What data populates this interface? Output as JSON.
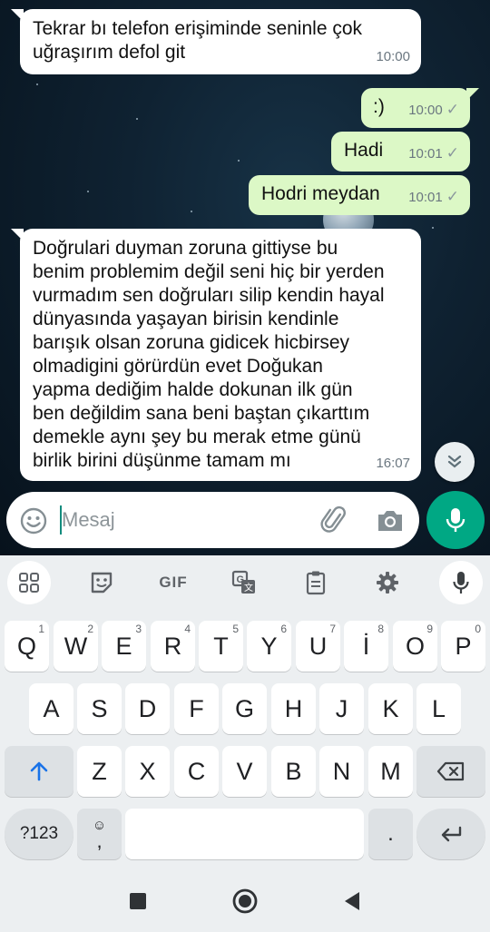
{
  "messages": [
    {
      "dir": "in",
      "text": "Tekrar bı telefon erişiminde seninle çok uğraşırım defol git",
      "time": "10:00"
    },
    {
      "dir": "out",
      "text": ":)",
      "time": "10:00",
      "tick": "✓"
    },
    {
      "dir": "out",
      "text": "Hadi",
      "time": "10:01",
      "tick": "✓"
    },
    {
      "dir": "out",
      "text": "Hodri meydan",
      "time": "10:01",
      "tick": "✓"
    },
    {
      "dir": "in",
      "lines": [
        "Doğrulari duyman zoruna gittiyse bu",
        "benim problemim değil seni hiç bir yerden",
        "vurmadım sen doğruları silip kendin hayal",
        "dünyasında yaşayan birisin kendinle",
        "barışık olsan zoruna gidicek hicbirsey",
        "olmadigini görürdün evet Doğukan",
        "yapma dediğim halde dokunan ilk gün",
        "ben değildim sana beni baştan çıkarttım",
        "demekle aynı şey bu merak etme günü",
        "birlik birini düşünme tamam mı"
      ],
      "time": "16:07"
    }
  ],
  "composer": {
    "placeholder": "Mesaj"
  },
  "keyboard": {
    "toolbar": [
      "apps-grid-icon",
      "sticker-icon",
      "GIF",
      "translate-icon",
      "clipboard-icon",
      "gear-icon",
      "mic-icon"
    ],
    "gif_label": "GIF",
    "row1": [
      {
        "k": "Q",
        "h": "1"
      },
      {
        "k": "W",
        "h": "2"
      },
      {
        "k": "E",
        "h": "3"
      },
      {
        "k": "R",
        "h": "4"
      },
      {
        "k": "T",
        "h": "5"
      },
      {
        "k": "Y",
        "h": "6"
      },
      {
        "k": "U",
        "h": "7"
      },
      {
        "k": "İ",
        "h": "8"
      },
      {
        "k": "O",
        "h": "9"
      },
      {
        "k": "P",
        "h": "0"
      }
    ],
    "row2": [
      "A",
      "S",
      "D",
      "F",
      "G",
      "H",
      "J",
      "K",
      "L"
    ],
    "row3": [
      "Z",
      "X",
      "C",
      "V",
      "B",
      "N",
      "M"
    ],
    "symbols_label": "?123",
    "comma_label": ",",
    "period_label": "."
  },
  "colors": {
    "accent": "#00a884",
    "outgoing": "#dcf8c6",
    "incoming": "#ffffff"
  }
}
